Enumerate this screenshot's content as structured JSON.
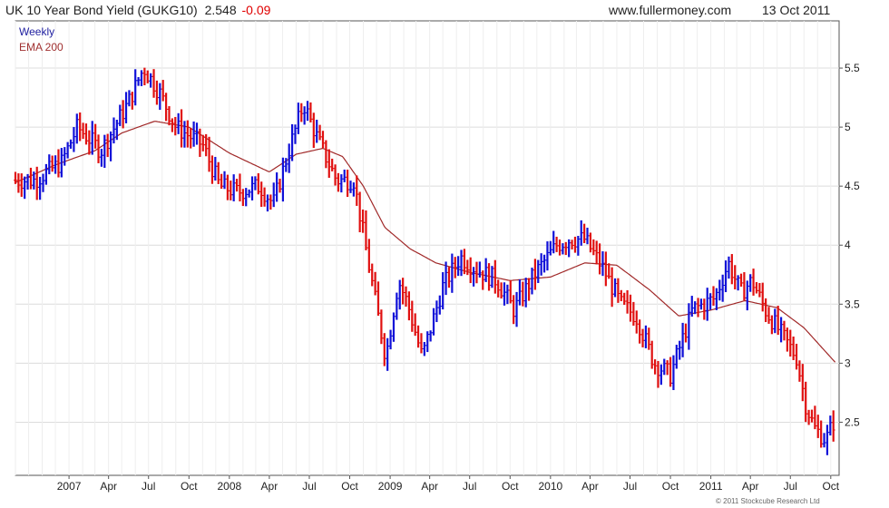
{
  "header": {
    "title": "UK 10 Year Bond Yield (GUKG10)",
    "last": "2.548",
    "change": "-0.09",
    "site": "www.fullermoney.com",
    "date": "13 Oct 2011"
  },
  "legend": {
    "weekly": "Weekly",
    "ema": "EMA 200"
  },
  "credit": "© 2011 Stockcube Research Ltd",
  "colors": {
    "up": "#1010d8",
    "down": "#e01010",
    "ema": "#a02828",
    "grid": "#dcdcdc",
    "axis": "#555555"
  },
  "chart_data": {
    "type": "ohlc",
    "interval": "weekly",
    "x_range": [
      "2006-09-01",
      "2011-10-20"
    ],
    "ylim": [
      2.05,
      5.9
    ],
    "y_ticks": [
      2.5,
      3,
      3.5,
      4,
      4.5,
      5,
      5.5
    ],
    "y_tick_labels": [
      "2.5",
      "3",
      "3.5",
      "4",
      "4.5",
      "5",
      "5.5"
    ],
    "x_ticks": [
      {
        "label": "2007",
        "date": "2007-01-01"
      },
      {
        "label": "Apr",
        "date": "2007-04-01"
      },
      {
        "label": "Jul",
        "date": "2007-07-01"
      },
      {
        "label": "Oct",
        "date": "2007-10-01"
      },
      {
        "label": "2008",
        "date": "2008-01-01"
      },
      {
        "label": "Apr",
        "date": "2008-04-01"
      },
      {
        "label": "Jul",
        "date": "2008-07-01"
      },
      {
        "label": "Oct",
        "date": "2008-10-01"
      },
      {
        "label": "2009",
        "date": "2009-01-01"
      },
      {
        "label": "Apr",
        "date": "2009-04-01"
      },
      {
        "label": "Jul",
        "date": "2009-07-01"
      },
      {
        "label": "Oct",
        "date": "2009-10-01"
      },
      {
        "label": "2010",
        "date": "2010-01-01"
      },
      {
        "label": "Apr",
        "date": "2010-04-01"
      },
      {
        "label": "Jul",
        "date": "2010-07-01"
      },
      {
        "label": "Oct",
        "date": "2010-10-01"
      },
      {
        "label": "2011",
        "date": "2011-01-01"
      },
      {
        "label": "Apr",
        "date": "2011-04-01"
      },
      {
        "label": "Jul",
        "date": "2011-07-01"
      },
      {
        "label": "Oct",
        "date": "2011-10-01"
      }
    ],
    "price_anchors": [
      [
        "2006-09-01",
        4.55
      ],
      [
        "2006-10-15",
        4.55
      ],
      [
        "2006-12-15",
        4.7
      ],
      [
        "2007-01-20",
        5.0
      ],
      [
        "2007-03-15",
        4.8
      ],
      [
        "2007-05-15",
        5.2
      ],
      [
        "2007-06-20",
        5.5
      ],
      [
        "2007-07-25",
        5.3
      ],
      [
        "2007-09-01",
        5.0
      ],
      [
        "2007-11-01",
        4.85
      ],
      [
        "2007-12-10",
        4.5
      ],
      [
        "2008-01-20",
        4.45
      ],
      [
        "2008-03-10",
        4.5
      ],
      [
        "2008-04-10",
        4.35
      ],
      [
        "2008-05-15",
        4.8
      ],
      [
        "2008-06-18",
        5.2
      ],
      [
        "2008-07-20",
        4.9
      ],
      [
        "2008-09-01",
        4.55
      ],
      [
        "2008-10-10",
        4.55
      ],
      [
        "2008-11-15",
        3.8
      ],
      [
        "2008-12-22",
        3.05
      ],
      [
        "2009-01-20",
        3.7
      ],
      [
        "2009-02-10",
        3.5
      ],
      [
        "2009-03-15",
        3.05
      ],
      [
        "2009-05-01",
        3.65
      ],
      [
        "2009-06-10",
        3.9
      ],
      [
        "2009-07-15",
        3.8
      ],
      [
        "2009-09-01",
        3.7
      ],
      [
        "2009-10-10",
        3.45
      ],
      [
        "2009-11-25",
        3.75
      ],
      [
        "2010-01-15",
        4.0
      ],
      [
        "2010-02-15",
        4.05
      ],
      [
        "2010-03-20",
        4.05
      ],
      [
        "2010-05-01",
        3.8
      ],
      [
        "2010-06-10",
        3.5
      ],
      [
        "2010-07-15",
        3.4
      ],
      [
        "2010-08-25",
        3.0
      ],
      [
        "2010-10-01",
        2.9
      ],
      [
        "2010-11-20",
        3.45
      ],
      [
        "2011-01-10",
        3.55
      ],
      [
        "2011-02-10",
        3.85
      ],
      [
        "2011-03-10",
        3.6
      ],
      [
        "2011-04-05",
        3.7
      ],
      [
        "2011-05-05",
        3.45
      ],
      [
        "2011-06-10",
        3.25
      ],
      [
        "2011-07-15",
        3.05
      ],
      [
        "2011-08-05",
        2.65
      ],
      [
        "2011-08-25",
        2.45
      ],
      [
        "2011-09-20",
        2.35
      ],
      [
        "2011-10-13",
        2.55
      ]
    ],
    "ema_anchors": [
      [
        "2006-09-01",
        4.53
      ],
      [
        "2006-12-01",
        4.68
      ],
      [
        "2007-03-01",
        4.8
      ],
      [
        "2007-05-01",
        4.95
      ],
      [
        "2007-07-15",
        5.05
      ],
      [
        "2007-10-01",
        5.0
      ],
      [
        "2008-01-01",
        4.78
      ],
      [
        "2008-04-01",
        4.62
      ],
      [
        "2008-06-01",
        4.77
      ],
      [
        "2008-08-01",
        4.82
      ],
      [
        "2008-09-15",
        4.75
      ],
      [
        "2008-11-01",
        4.5
      ],
      [
        "2008-12-20",
        4.15
      ],
      [
        "2009-02-15",
        3.97
      ],
      [
        "2009-04-15",
        3.85
      ],
      [
        "2009-07-01",
        3.77
      ],
      [
        "2009-10-01",
        3.7
      ],
      [
        "2010-01-01",
        3.73
      ],
      [
        "2010-03-20",
        3.85
      ],
      [
        "2010-06-01",
        3.83
      ],
      [
        "2010-08-15",
        3.62
      ],
      [
        "2010-10-20",
        3.4
      ],
      [
        "2011-01-01",
        3.45
      ],
      [
        "2011-03-20",
        3.53
      ],
      [
        "2011-06-01",
        3.47
      ],
      [
        "2011-08-01",
        3.3
      ],
      [
        "2011-10-13",
        3.0
      ]
    ]
  }
}
